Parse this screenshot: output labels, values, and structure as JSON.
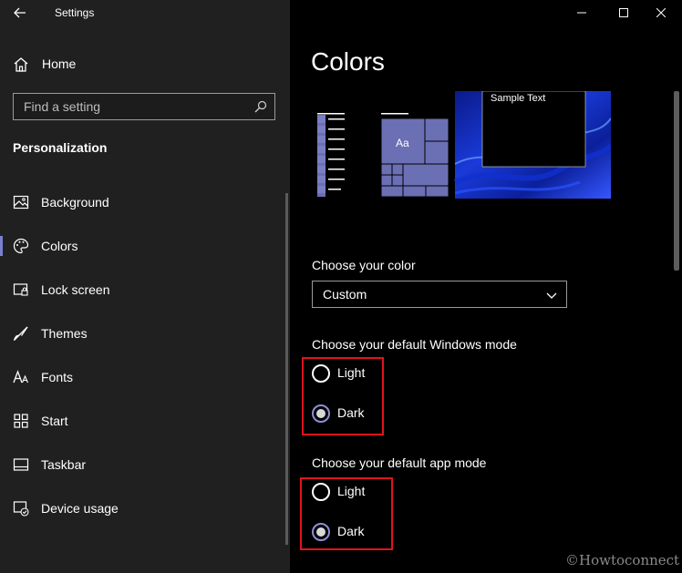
{
  "window": {
    "title": "Settings",
    "controls": {
      "minimize": "minimize-icon",
      "maximize": "maximize-icon",
      "close": "close-icon"
    }
  },
  "sidebar": {
    "home_label": "Home",
    "search_placeholder": "Find a setting",
    "section_title": "Personalization",
    "items": [
      {
        "label": "Background",
        "icon": "image-icon"
      },
      {
        "label": "Colors",
        "icon": "palette-icon",
        "selected": true
      },
      {
        "label": "Lock screen",
        "icon": "lock-screen-icon"
      },
      {
        "label": "Themes",
        "icon": "brush-icon"
      },
      {
        "label": "Fonts",
        "icon": "font-icon"
      },
      {
        "label": "Start",
        "icon": "start-icon"
      },
      {
        "label": "Taskbar",
        "icon": "taskbar-icon"
      },
      {
        "label": "Device usage",
        "icon": "device-usage-icon"
      }
    ]
  },
  "main": {
    "title": "Colors",
    "preview": {
      "sample_text": "Sample Text",
      "tile_text": "Aa",
      "accent": "#6b6fb4"
    },
    "choose_color": {
      "label": "Choose your color",
      "selected": "Custom"
    },
    "windows_mode": {
      "label": "Choose your default Windows mode",
      "options": [
        "Light",
        "Dark"
      ],
      "selected": "Dark"
    },
    "app_mode": {
      "label": "Choose your default app mode",
      "options": [
        "Light",
        "Dark"
      ],
      "selected": "Dark"
    }
  },
  "watermark": "©Howtoconnect",
  "colors": {
    "sidebar_bg": "#202020",
    "main_bg": "#000000",
    "accent": "#7a7fd0",
    "highlight_box": "#e0131d"
  }
}
